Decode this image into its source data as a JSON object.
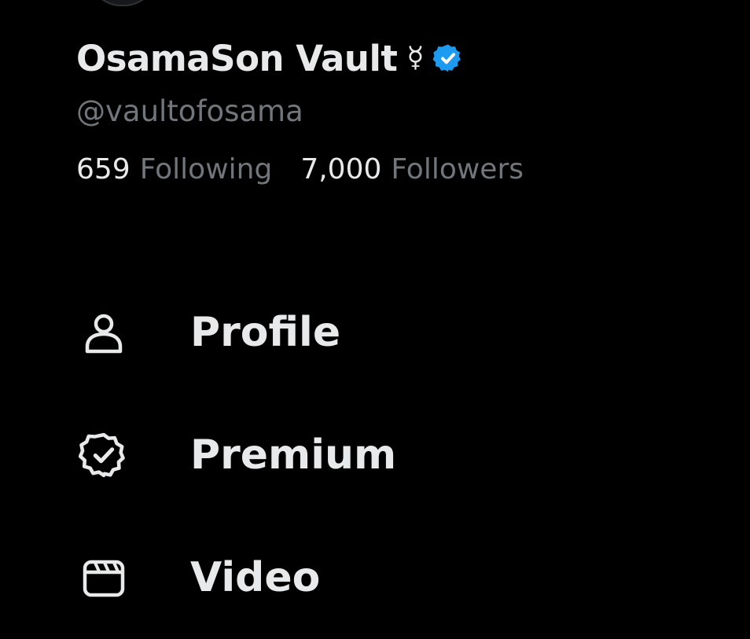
{
  "profile": {
    "display_name": "OsamaSon Vault",
    "name_symbol": "☿",
    "handle": "@vaultofosama",
    "verified_color": "#1d9bf0"
  },
  "stats": [
    {
      "count": "659",
      "label": "Following"
    },
    {
      "count": "7,000",
      "label": "Followers"
    }
  ],
  "menu": [
    {
      "label": "Profile",
      "icon": "person-icon"
    },
    {
      "label": "Premium",
      "icon": "verified-badge-outline-icon"
    },
    {
      "label": "Video",
      "icon": "clapperboard-icon"
    }
  ],
  "colors": {
    "background": "#000000",
    "primary_text": "#e7e9ea",
    "secondary_text": "#71767b"
  }
}
